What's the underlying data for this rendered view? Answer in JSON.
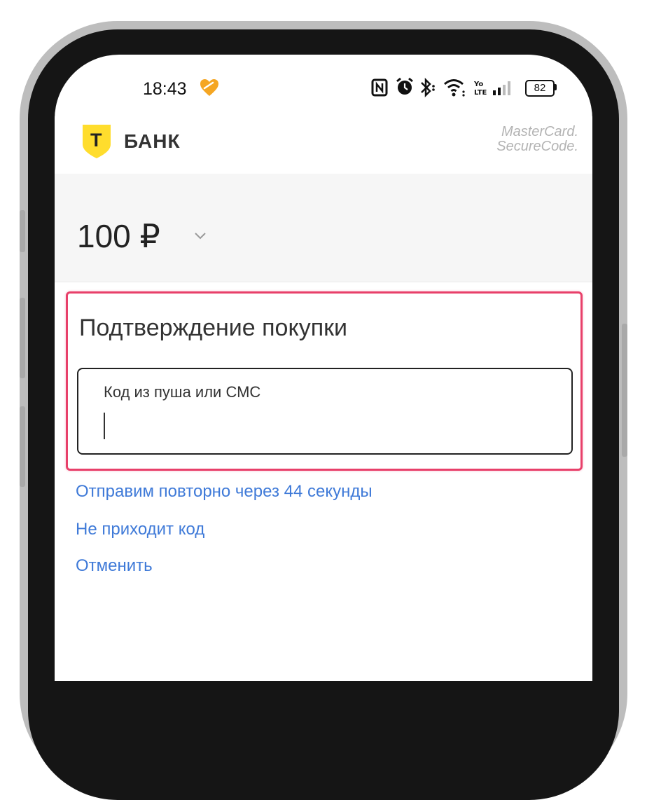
{
  "status_bar": {
    "time": "18:43",
    "battery": "82",
    "icons": [
      "nfc-icon",
      "alarm-icon",
      "bluetooth-icon",
      "wifi-icon",
      "volte-icon",
      "signal-icon",
      "battery-icon"
    ]
  },
  "header": {
    "logo_letter": "Т",
    "bank_name": "БАНК",
    "brand_line1": "MasterCard.",
    "brand_line2": "SecureCode."
  },
  "amount": {
    "value": "100 ₽"
  },
  "confirmation": {
    "title": "Подтверждение покупки",
    "code_label": "Код из пуша или СМС",
    "code_value": ""
  },
  "links": {
    "resend": "Отправим повторно через 44 секунды",
    "no_code": "Не приходит код",
    "cancel": "Отменить"
  },
  "colors": {
    "logo_yellow": "#ffdd2d",
    "link_blue": "#3f7ad8",
    "highlight_pink": "#e8406a"
  }
}
